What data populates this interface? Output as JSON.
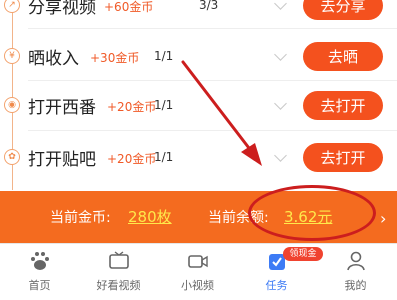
{
  "tasks": [
    {
      "title": "分享视频",
      "reward": "+60金币",
      "progress": "3/3",
      "action": "去分享",
      "node_icon": "share-icon"
    },
    {
      "title": "晒收入",
      "reward": "+30金币",
      "progress": "1/1",
      "action": "去晒",
      "node_icon": "yen-icon"
    },
    {
      "title": "打开西番",
      "reward": "+20金币",
      "progress": "1/1",
      "action": "去打开",
      "node_icon": "eye-icon"
    },
    {
      "title": "打开贴吧",
      "reward": "+20金币",
      "progress": "1/1",
      "action": "去打开",
      "node_icon": "paw-icon"
    }
  ],
  "balance": {
    "coins_label": "当前金币:",
    "coins_value": "280枚",
    "money_label": "当前余额:",
    "money_value": "3.62元"
  },
  "tabbar": {
    "items": [
      {
        "label": "首页",
        "icon": "paw-icon",
        "active": false
      },
      {
        "label": "好看视频",
        "icon": "tv-icon",
        "active": false
      },
      {
        "label": "小视频",
        "icon": "video-camera-icon",
        "active": false
      },
      {
        "label": "任务",
        "icon": "checkbox-icon",
        "active": true
      },
      {
        "label": "我的",
        "icon": "person-icon",
        "active": false
      }
    ],
    "badge": "领现金"
  },
  "colors": {
    "accent": "#f4511e",
    "balance_bar": "#f46b1f",
    "balance_value": "#ffe84a",
    "tab_active": "#3d7bf5",
    "annotation": "#cc1e1e"
  }
}
